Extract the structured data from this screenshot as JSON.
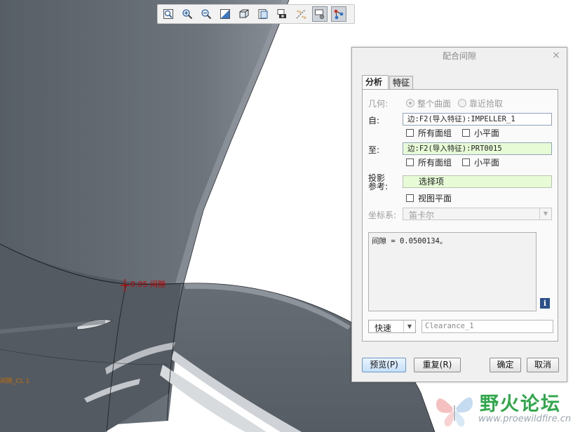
{
  "viewport": {
    "annotation": "0.05 间隙",
    "side_label": "间隙_CL 1"
  },
  "toolbar": {
    "buttons": [
      {
        "name": "zoom-fit-icon",
        "active": false
      },
      {
        "name": "zoom-in-icon",
        "active": false
      },
      {
        "name": "zoom-out-icon",
        "active": false
      },
      {
        "name": "repaint-icon",
        "active": false
      },
      {
        "name": "display-style-icon",
        "active": false
      },
      {
        "name": "saved-views-icon",
        "active": false
      },
      {
        "name": "view-manager-icon",
        "active": false
      },
      {
        "name": "datum-display-icon",
        "active": false
      },
      {
        "name": "annotation-display-icon",
        "active": true
      },
      {
        "name": "spin-center-icon",
        "active": true
      }
    ]
  },
  "dialog": {
    "title": "配合间隙",
    "tabs": [
      "分析",
      "特征"
    ],
    "geometry_label": "几何:",
    "geometry_option1": "整个曲面",
    "geometry_option2": "靠近拾取",
    "from_label": "自:",
    "from_value": "边:F2(导入特征):IMPELLER_1",
    "from_all_quilts": "所有面组",
    "from_facet": "小平面",
    "to_label": "至:",
    "to_value": "边:F2(导入特征):PRT0015",
    "to_all_quilts": "所有面组",
    "to_facet": "小平面",
    "projection_label_line1": "投影",
    "projection_label_line2": "参考:",
    "projection_value": "选择项",
    "view_plane": "视图平面",
    "csys_label": "坐标系:",
    "csys_value": "笛卡尔",
    "result": "间隙 = 0.0500134。",
    "quick_value": "快速",
    "name_value": "Clearance_1",
    "preview_button": "预览(P)",
    "repeat_button": "重复(R)",
    "ok_button": "确定",
    "cancel_button": "取消"
  },
  "watermark": {
    "text": "野火论坛",
    "url": "www.proewildfire.cn"
  },
  "colors": {
    "model_dark": "#4d545b",
    "model_mid": "#6a7179",
    "field_green": "#e6fbd6",
    "field_white": "#ffffff",
    "annotation_red": "#c00000",
    "side_label_orange": "#c86e00",
    "watermark_green": "#2ea84a"
  }
}
